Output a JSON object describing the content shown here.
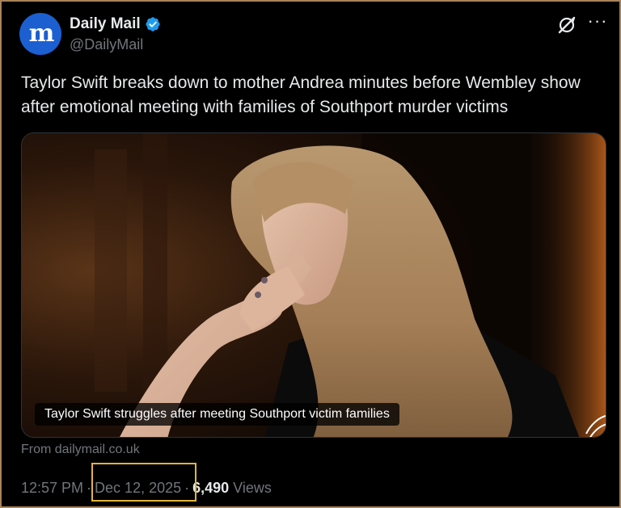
{
  "author": {
    "display_name": "Daily Mail",
    "handle": "@DailyMail",
    "avatar_letters": "m",
    "verified": true
  },
  "tweet": {
    "text": "Taylor Swift breaks down to mother Andrea minutes before Wembley show after emotional meeting with families of Southport murder victims"
  },
  "media": {
    "caption": "Taylor Swift struggles after meeting Southport victim families"
  },
  "source": "From dailymail.co.uk",
  "meta": {
    "time": "12:57 PM",
    "date": "Dec 12, 2025",
    "views_count": "6,490",
    "views_label": "Views",
    "separator": "·"
  },
  "colors": {
    "background": "#000000",
    "text_primary": "#e7e9ea",
    "text_secondary": "#71767b",
    "verified_blue": "#1d9bf0",
    "avatar_blue": "#1b5fd0",
    "highlight_box": "#e1b43a"
  },
  "icons": {
    "verified": "verified-badge-icon",
    "grok": "grok-icon",
    "more": "more-options-icon"
  }
}
